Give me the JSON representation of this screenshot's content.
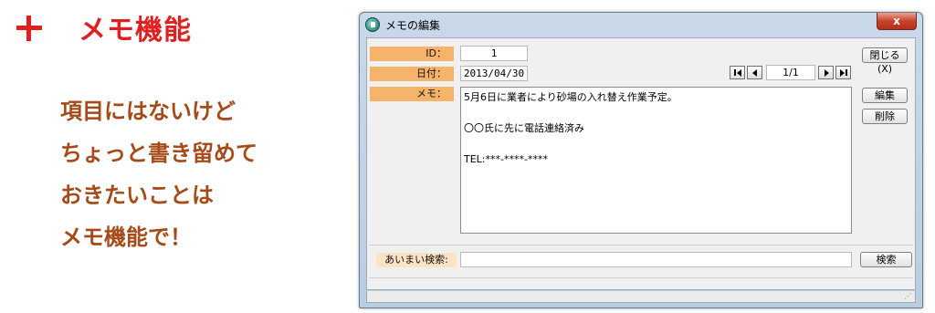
{
  "promo": {
    "title": "メモ機能",
    "lines": [
      "項目にはないけど",
      "ちょっと書き留めて",
      "おきたいことは",
      "メモ機能で！"
    ]
  },
  "window": {
    "title": "メモの編集",
    "close_label": "x"
  },
  "form": {
    "id_label": "ID：",
    "id_value": "1",
    "date_label": "日付：",
    "date_value": "2013/04/30",
    "memo_label": "メモ：",
    "memo_lines": [
      "5月6日に業者により砂場の入れ替え作業予定。",
      "",
      "〇〇氏に先に電話連絡済み",
      "",
      "TEL:***-****-****"
    ],
    "record_position": "1/1",
    "search_label": "あいまい検索:",
    "search_value": ""
  },
  "buttons": {
    "close": "閉じる(X)",
    "edit": "編集",
    "delete": "削除",
    "search": "検索"
  },
  "colors": {
    "accent_red": "#e02020",
    "promo_text": "#a54a18",
    "label_bg": "#f6b46b"
  },
  "icons": {
    "plus": "plus-icon",
    "app": "app-icon",
    "first": "first-record-icon",
    "prev": "prev-record-icon",
    "next": "next-record-icon",
    "last": "last-record-icon"
  }
}
